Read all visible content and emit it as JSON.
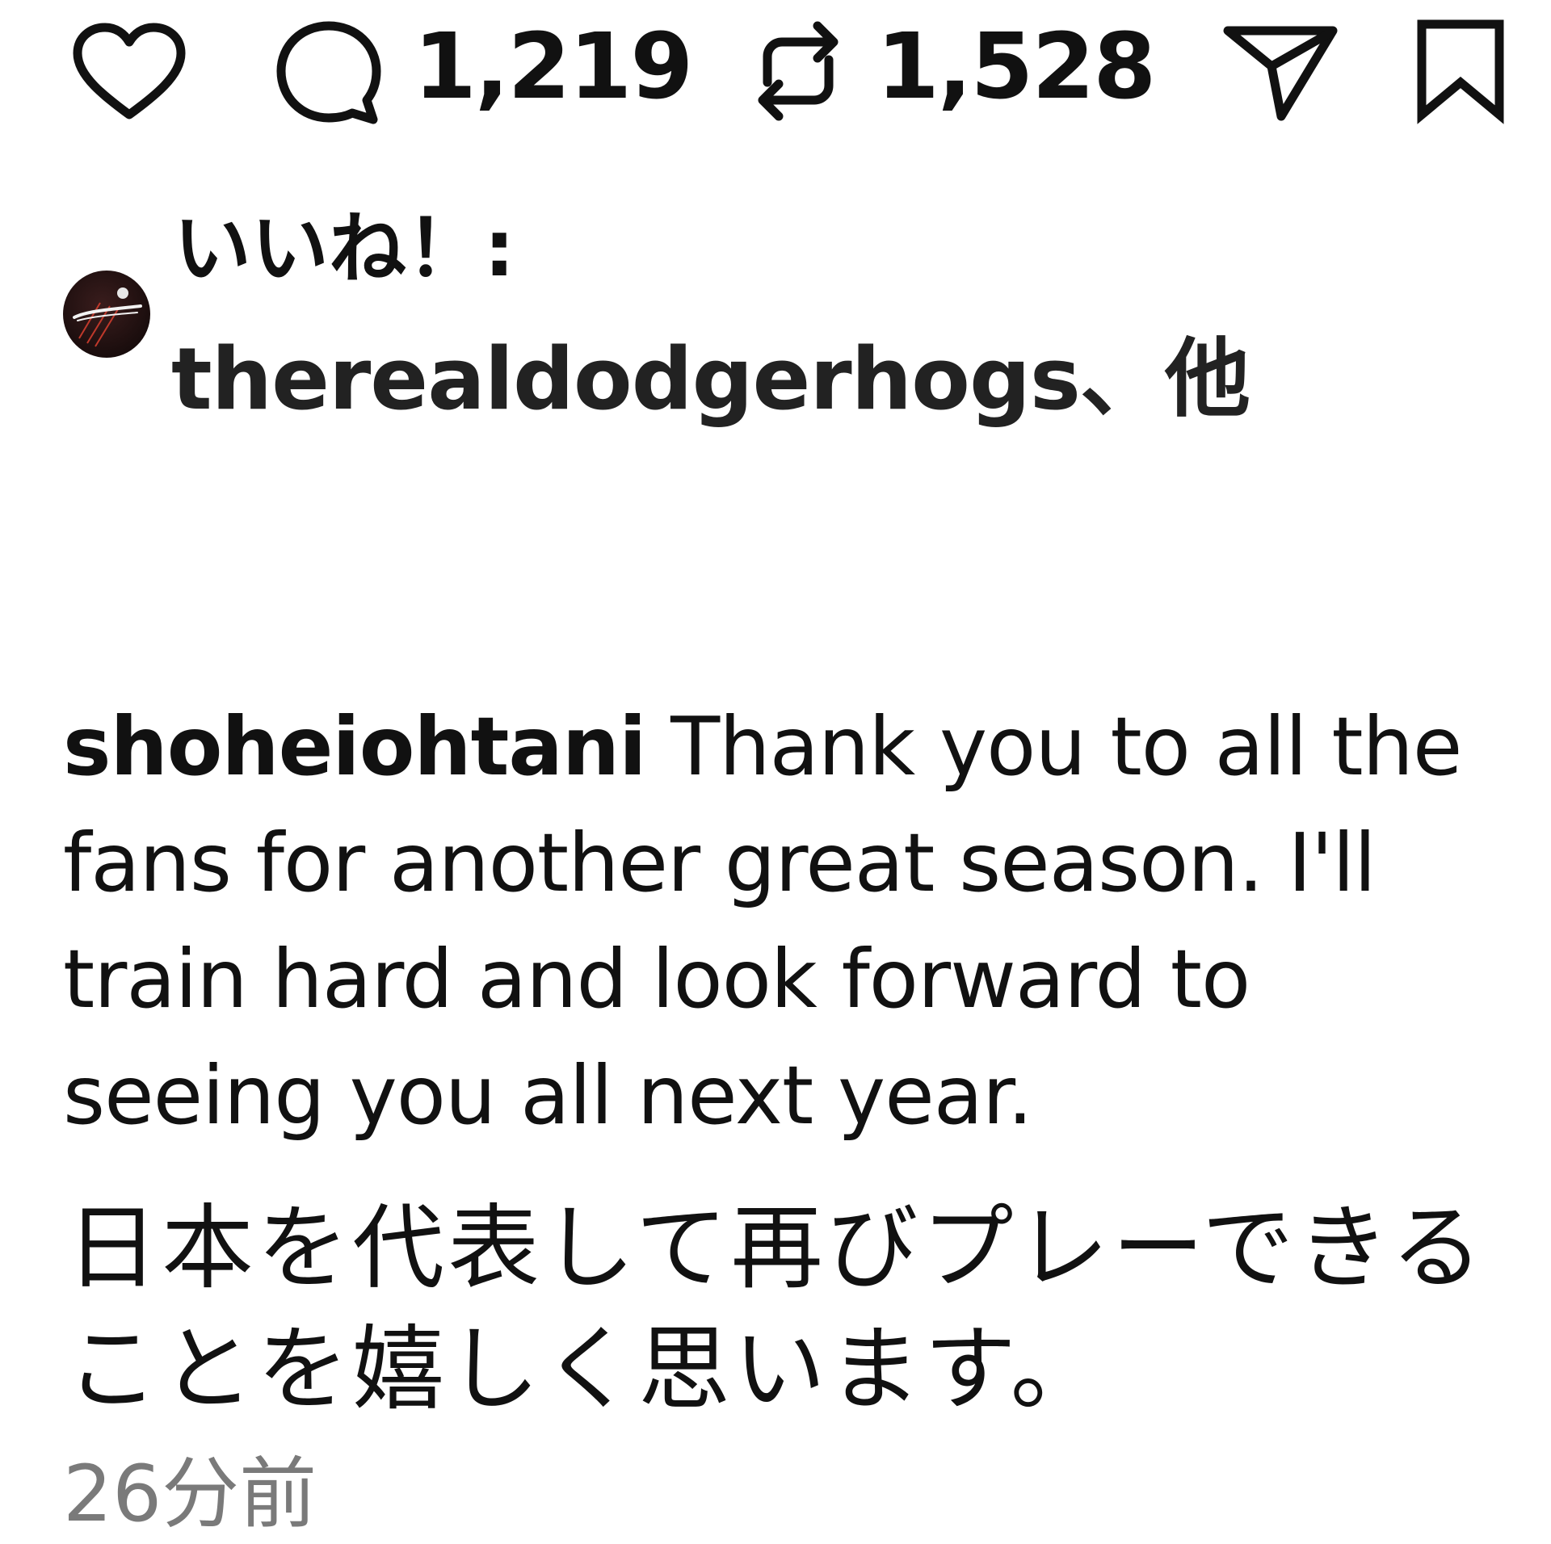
{
  "actions": {
    "like": {
      "icon": "heart-icon"
    },
    "comment": {
      "icon": "comment-bubble-icon",
      "count": "1,219"
    },
    "repost": {
      "icon": "repost-arrows-icon",
      "count": "1,528"
    },
    "share": {
      "icon": "send-paper-plane-icon"
    },
    "save": {
      "icon": "bookmark-icon"
    }
  },
  "likes": {
    "prefix": "いいね！:",
    "users": "therealdodgerhogs、他",
    "avatar_icon": "dodgerhogs-avatar-icon"
  },
  "caption": {
    "username": "shoheiohtani",
    "text_en": "Thank you to all the fans for another great season. I'll train hard and look forward to seeing you all next year.",
    "text_jp": "日本を代表して再びプレーできることを嬉しく思います。"
  },
  "timestamp": "26分前",
  "colors": {
    "text": "#111111",
    "muted": "#7a7a7a",
    "background": "#ffffff",
    "avatar_accent": "#c0392b"
  }
}
